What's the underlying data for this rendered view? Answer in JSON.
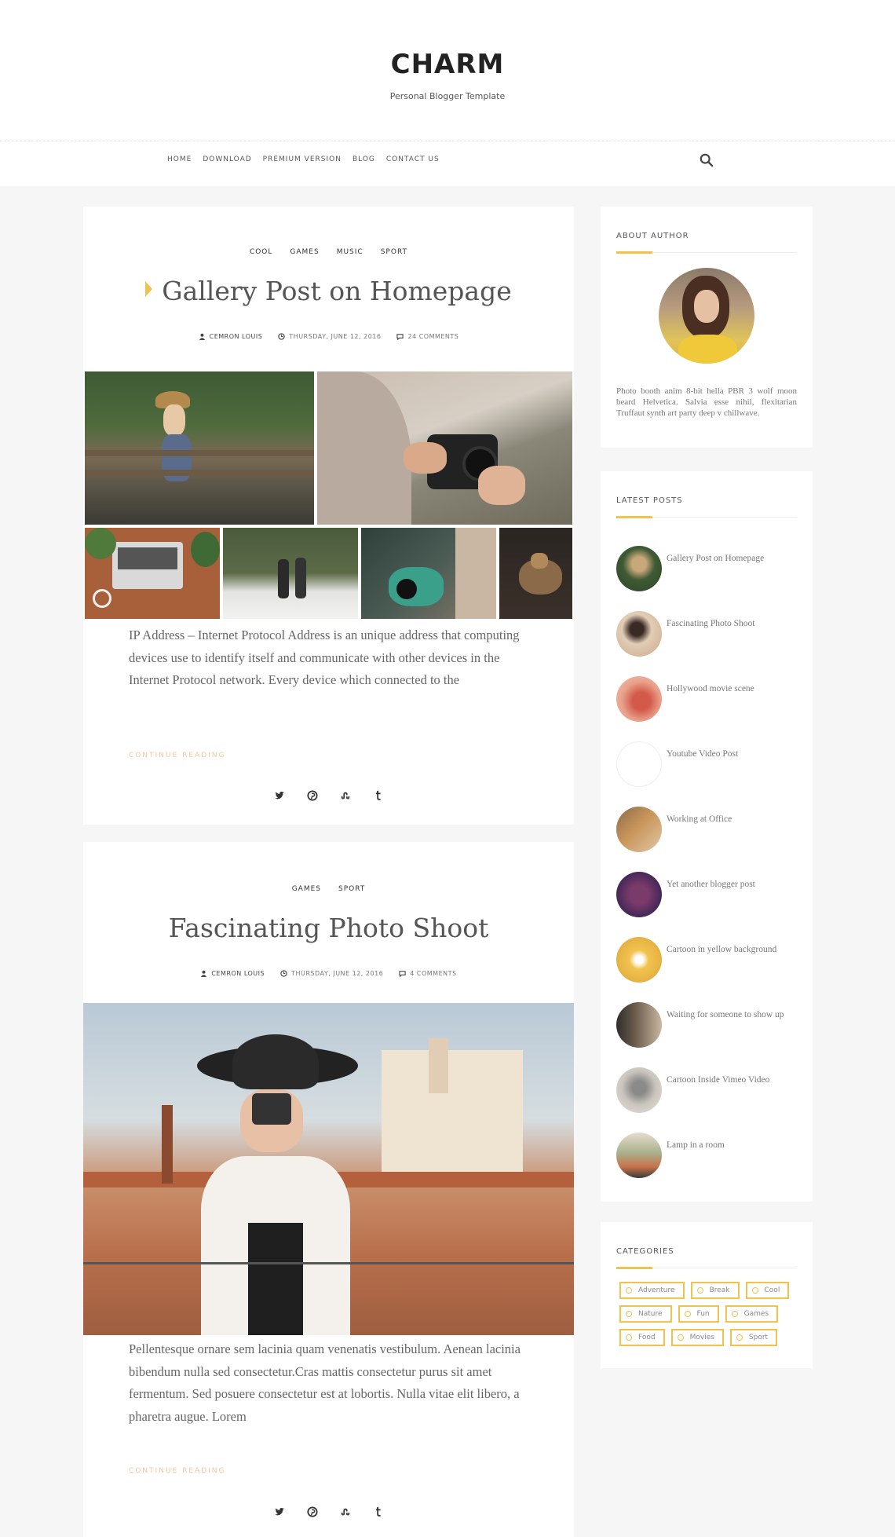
{
  "site": {
    "title": "CHARM",
    "tagline": "Personal Blogger Template"
  },
  "nav": {
    "items": [
      "HOME",
      "DOWNLOAD",
      "PREMIUM VERSION",
      "BLOG",
      "CONTACT US"
    ]
  },
  "posts": [
    {
      "categories": [
        "COOL",
        "GAMES",
        "MUSIC",
        "SPORT"
      ],
      "title": "Gallery Post on Homepage",
      "author": "CEMRON LOUIS",
      "date": "THURSDAY, JUNE 12, 2016",
      "comments": "24 COMMENTS",
      "excerpt": "IP Address – Internet Protocol Address is an unique address that computing devices use to identify itself and communicate with other devices in the Internet Protocol network. Every device which connected to the",
      "read_more": "CONTINUE READING"
    },
    {
      "categories": [
        "GAMES",
        "SPORT"
      ],
      "title": "Fascinating Photo Shoot",
      "author": "CEMRON LOUIS",
      "date": "THURSDAY, JUNE 12, 2016",
      "comments": "4 COMMENTS",
      "excerpt": "Pellentesque ornare sem lacinia quam venenatis vestibulum. Aenean lacinia bibendum nulla sed consectetur.Cras mattis consectetur purus sit amet fermentum. Sed posuere consectetur est at lobortis. Nulla vitae elit libero, a pharetra augue. Lorem",
      "read_more": "CONTINUE READING"
    }
  ],
  "share_icons": [
    "twitter-icon",
    "pinterest-icon",
    "stumbleupon-icon",
    "tumblr-icon"
  ],
  "sidebar": {
    "about": {
      "title": "ABOUT AUTHOR",
      "text": "Photo booth anim 8-bit hella PBR 3 wolf moon beard Helvetica. Salvia esse nihil, flexitarian Truffaut synth art party deep v chillwave."
    },
    "latest": {
      "title": "LATEST POSTS",
      "items": [
        "Gallery Post on Homepage",
        "Fascinating Photo Shoot",
        "Hollywood movie scene",
        "Youtube Video Post",
        "Working at Office",
        "Yet another blogger post",
        "Cartoon in yellow background",
        "Waiting for someone to show up",
        "Cartoon Inside Vimeo Video",
        "Lamp in a room"
      ]
    },
    "categories": {
      "title": "CATEGORIES",
      "items": [
        "Adventure",
        "Break",
        "Cool",
        "Nature",
        "Fun",
        "Games",
        "Food",
        "Movies",
        "Sport"
      ]
    }
  },
  "colors": {
    "accent": "#f2c24f",
    "read_more": "#f2c79a",
    "background": "#f6f6f6"
  }
}
